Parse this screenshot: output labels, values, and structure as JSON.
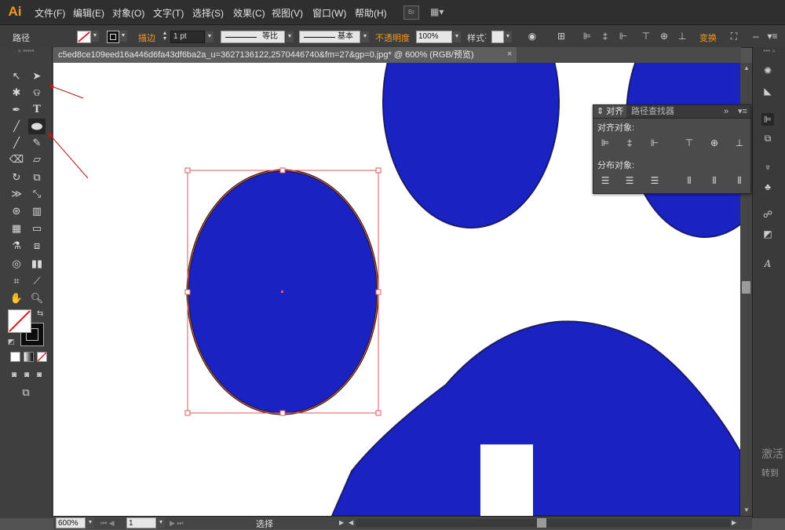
{
  "app": {
    "logo": "Ai"
  },
  "menu": {
    "items": [
      "文件(F)",
      "编辑(E)",
      "对象(O)",
      "文字(T)",
      "选择(S)",
      "效果(C)",
      "视图(V)",
      "窗口(W)",
      "帮助(H)"
    ],
    "bridge_label": "Br",
    "arrange_icon": "arrange-documents-icon"
  },
  "control": {
    "selection_label": "路径",
    "stroke_label": "描边",
    "stroke_weight": "1 pt",
    "profile_label": "等比",
    "brush_label": "基本",
    "opacity_label": "不透明度",
    "opacity_value": "100%",
    "style_label": "样式",
    "transform_label": "变换"
  },
  "document": {
    "tab_title": "c5ed8ce109eed16a446d6fa43df6ba2a_u=3627136122,2570446740&fm=27&gp=0.jpg*  @  600%  (RGB/预览)",
    "close": "×"
  },
  "status": {
    "zoom": "600%",
    "artboard": "1",
    "tool_name": "选择"
  },
  "align_panel": {
    "tab_align": "对齐",
    "tab_pathfinder": "路径查找器",
    "align_objects_label": "对齐对象:",
    "distribute_objects_label": "分布对象:",
    "collapse_icon": "»",
    "menu_icon": "▾≡"
  },
  "watermark": {
    "line1": "激活",
    "line2": "转到"
  },
  "colors": {
    "shape_blue": "#1a22c2",
    "accent_orange": "#f39a1d",
    "selection_red": "#e0585a"
  }
}
